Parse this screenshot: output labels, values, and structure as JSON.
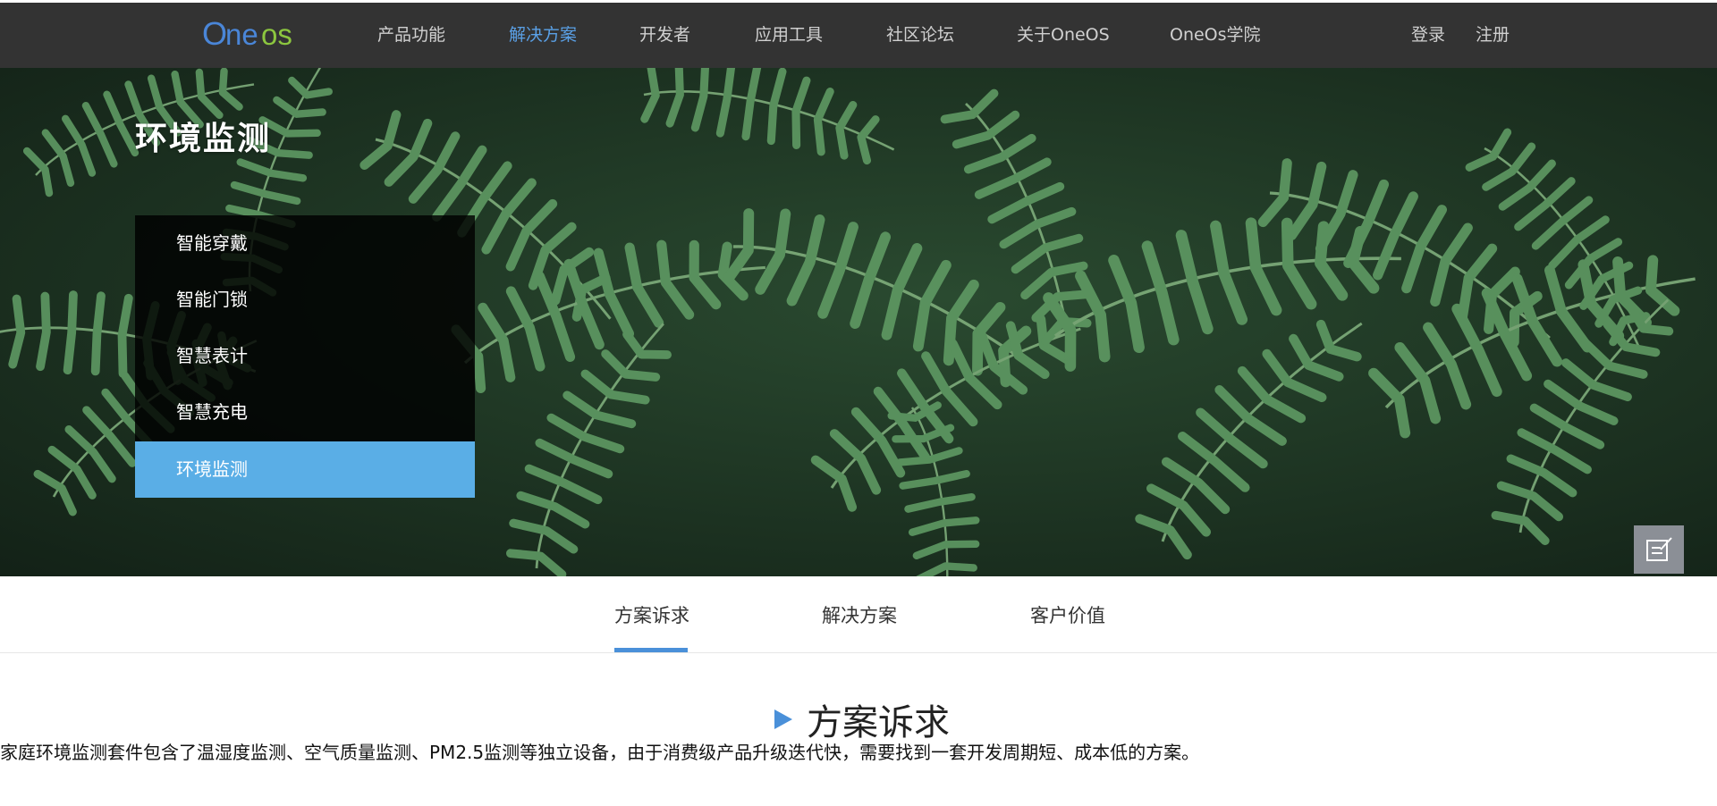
{
  "header": {
    "logo_text": "Oneos",
    "nav": [
      {
        "label": "产品功能",
        "active": false
      },
      {
        "label": "解决方案",
        "active": true
      },
      {
        "label": "开发者",
        "active": false
      },
      {
        "label": "应用工具",
        "active": false
      },
      {
        "label": "社区论坛",
        "active": false
      },
      {
        "label": "关于OneOS",
        "active": false
      },
      {
        "label": "OneOs学院",
        "active": false
      }
    ],
    "login_label": "登录",
    "register_label": "注册"
  },
  "hero": {
    "title": "环境监测",
    "menu": [
      {
        "label": "智能穿戴",
        "active": false
      },
      {
        "label": "智能门锁",
        "active": false
      },
      {
        "label": "智慧表计",
        "active": false
      },
      {
        "label": "智慧充电",
        "active": false
      },
      {
        "label": "环境监测",
        "active": true
      }
    ]
  },
  "float_buttons": [
    {
      "icon": "edit-note-icon"
    },
    {
      "icon": "add-user-icon"
    }
  ],
  "tabs": [
    {
      "label": "方案诉求",
      "active": true
    },
    {
      "label": "解决方案",
      "active": false
    },
    {
      "label": "客户价值",
      "active": false
    }
  ],
  "content": {
    "heading": "方案诉求",
    "body": "家庭环境监测套件包含了温湿度监测、空气质量监测、PM2.5监测等独立设备，由于消费级产品升级迭代快，需要找到一套开发周期短、成本低的方案。"
  },
  "colors": {
    "header_bg": "#333333",
    "accent": "#4a90d9",
    "menu_active": "#5aaee6",
    "nav_active": "#5aa0e6"
  }
}
